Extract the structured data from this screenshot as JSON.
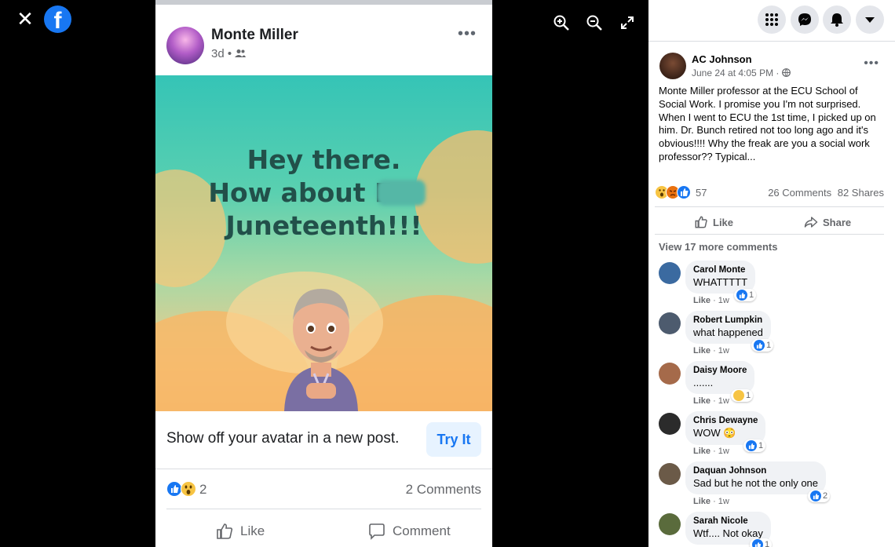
{
  "viewer": {
    "close_icon": "close-icon",
    "logo": "facebook-logo",
    "tools": [
      "zoom-in-icon",
      "zoom-out-icon",
      "fullscreen-icon"
    ]
  },
  "photo": {
    "author": "Monte Miller",
    "meta_time": "3d",
    "meta_sep": "•",
    "more": "•••",
    "banner_lines": [
      "Hey there.",
      "How about F",
      "Juneteenth!!!"
    ],
    "cta_text": "Show off your avatar in a new post.",
    "cta_button": "Try It",
    "reaction_count": "2",
    "comments_count": "2 Comments",
    "like_label": "Like",
    "comment_label": "Comment"
  },
  "panel": {
    "buttons": [
      "menu-grid-icon",
      "messenger-icon",
      "notifications-icon",
      "account-dropdown-icon"
    ],
    "post": {
      "author": "AC Johnson",
      "date": "June 24 at 4:05 PM ·",
      "more": "•••",
      "text": "Monte Miller professor at the ECU School of Social Work. I promise you I'm not surprised. When I went to ECU the 1st time, I picked up on him. Dr. Bunch retired not too long ago and it's obvious!!!! Why the freak are you a social work professor?? Typical...",
      "reaction_count": "57",
      "comments": "26 Comments",
      "shares": "82 Shares",
      "like_label": "Like",
      "share_label": "Share",
      "view_more": "View 17 more comments"
    },
    "comments": [
      {
        "name": "Carol Monte",
        "text": "WHATTTTT",
        "like": "Like",
        "time": "1w",
        "react_count": "1",
        "react": "like",
        "avatar_color": "#3b6aa0"
      },
      {
        "name": "Robert Lumpkin",
        "text": "what happened",
        "like": "Like",
        "time": "1w",
        "react_count": "1",
        "react": "like",
        "avatar_color": "#4d5b6e"
      },
      {
        "name": "Daisy Moore",
        "text": ".......",
        "like": "Like",
        "time": "1w",
        "react_count": "1",
        "react": "haha",
        "avatar_color": "#a56a4a"
      },
      {
        "name": "Chris Dewayne",
        "text": "WOW 😳",
        "like": "Like",
        "time": "1w",
        "react_count": "1",
        "react": "like",
        "avatar_color": "#2b2b2b"
      },
      {
        "name": "Daquan Johnson",
        "text": "Sad but he not the only one",
        "like": "Like",
        "time": "1w",
        "react_count": "2",
        "react": "like",
        "avatar_color": "#6b5a48"
      },
      {
        "name": "Sarah Nicole",
        "text": "Wtf.... Not okay",
        "like": "",
        "time": "",
        "react_count": "1",
        "react": "like",
        "avatar_color": "#5a6b3c"
      }
    ]
  },
  "colors": {
    "brand": "#1877f2",
    "muted": "#65676b",
    "bubble": "#f0f2f5"
  }
}
